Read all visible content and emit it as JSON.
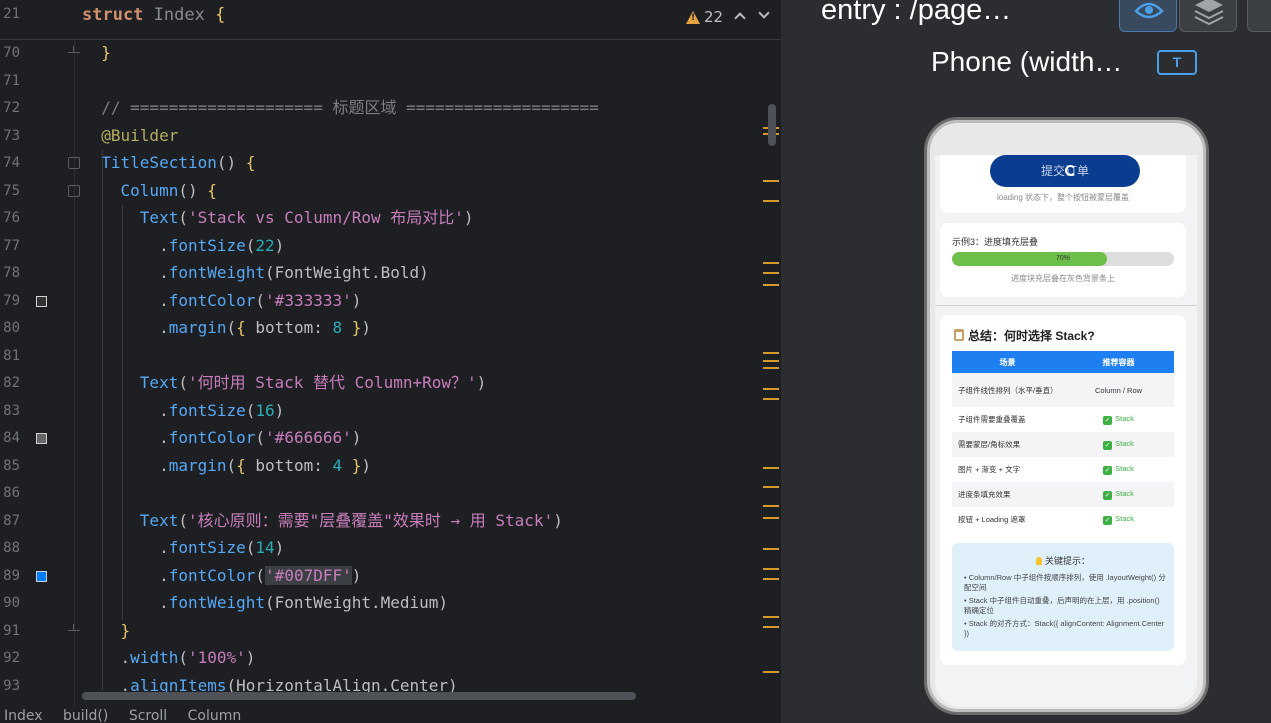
{
  "editor": {
    "sticky": {
      "line": "21",
      "keyword": "struct",
      "class_name": "Index",
      "brace": "{"
    },
    "warnings": {
      "count": "22"
    },
    "lines": [
      {
        "n": "70",
        "text": "  }"
      },
      {
        "n": "71",
        "text": ""
      },
      {
        "n": "72",
        "text": "  // ==================== 标题区域 ===================="
      },
      {
        "n": "73",
        "text": "  @Builder"
      },
      {
        "n": "74",
        "text": "  TitleSection() {"
      },
      {
        "n": "75",
        "text": "    Column() {"
      },
      {
        "n": "76",
        "text": "      Text('Stack vs Column/Row 布局对比')"
      },
      {
        "n": "77",
        "text": "        .fontSize(22)"
      },
      {
        "n": "78",
        "text": "        .fontWeight(FontWeight.Bold)"
      },
      {
        "n": "79",
        "text": "        .fontColor('#333333')"
      },
      {
        "n": "80",
        "text": "        .margin({ bottom: 8 })"
      },
      {
        "n": "81",
        "text": ""
      },
      {
        "n": "82",
        "text": "      Text('何时用 Stack 替代 Column+Row？')"
      },
      {
        "n": "83",
        "text": "        .fontSize(16)"
      },
      {
        "n": "84",
        "text": "        .fontColor('#666666')"
      },
      {
        "n": "85",
        "text": "        .margin({ bottom: 4 })"
      },
      {
        "n": "86",
        "text": ""
      },
      {
        "n": "87",
        "text": "      Text('核心原则：需要\"层叠覆盖\"效果时 → 用 Stack')"
      },
      {
        "n": "88",
        "text": "        .fontSize(14)"
      },
      {
        "n": "89",
        "text": "        .fontColor('#007DFF')"
      },
      {
        "n": "90",
        "text": "        .fontWeight(FontWeight.Medium)"
      },
      {
        "n": "91",
        "text": "    }"
      },
      {
        "n": "92",
        "text": "    .width('100%')"
      },
      {
        "n": "93",
        "text": "    .alignItems(HorizontalAlign.Center)"
      }
    ],
    "swatch_colors": {
      "79": "#333333",
      "84": "#666666",
      "89": "#007DFF"
    },
    "breadcrumb": [
      "Index",
      "build()",
      "Scroll",
      "Column"
    ]
  },
  "preview": {
    "title": "entry : /page…",
    "device_label": "Phone (width…",
    "device_icon_glyph": "T",
    "app": {
      "submit_button": "提交订单",
      "loading_caption": "loading 状态下，整个按钮被蒙层覆盖",
      "progress": {
        "title": "示例3：进度填充层叠",
        "value": 70,
        "label": "70%",
        "caption": "进度块充层叠在灰色背景条上"
      },
      "summary": {
        "title": "总结：何时选择 Stack?",
        "header": [
          "场景",
          "推荐容器"
        ],
        "rows": [
          {
            "scene": "子组件线性排列（水平/垂直）",
            "container": "Column / Row",
            "check": false
          },
          {
            "scene": "子组件需要重叠覆盖",
            "container": "Stack",
            "check": true
          },
          {
            "scene": "需要蒙层/角标效果",
            "container": "Stack",
            "check": true
          },
          {
            "scene": "图片 + 渐变 + 文字",
            "container": "Stack",
            "check": true
          },
          {
            "scene": "进度条填充效果",
            "container": "Stack",
            "check": true
          },
          {
            "scene": "按钮 + Loading 遮罩",
            "container": "Stack",
            "check": true
          }
        ],
        "tips_title": "关键提示：",
        "tips": [
          "• Column/Row 中子组件按顺序排列，使用 .layoutWeight() 分配空间",
          "• Stack 中子组件自动重叠，后声明的在上层，用 .position() 精确定位",
          "• Stack 的对齐方式：Stack({ alignContent: Alignment.Center })"
        ]
      }
    }
  },
  "colors": {
    "keyword": "#cf8e6d",
    "string": "#c77dbb",
    "number": "#2aacb8",
    "method": "#56a8f5",
    "annotation": "#b3ae60",
    "comment": "#7a7e85",
    "accent_blue": "#1e80f0",
    "progress_green": "#6cc04a",
    "warning": "#e6a33e"
  },
  "icons": [
    "warning-icon",
    "chevron-up-icon",
    "chevron-down-icon",
    "eye-icon",
    "layers-icon",
    "text-device-icon",
    "spinner-icon",
    "clipboard-icon",
    "check-icon",
    "bulb-icon"
  ]
}
